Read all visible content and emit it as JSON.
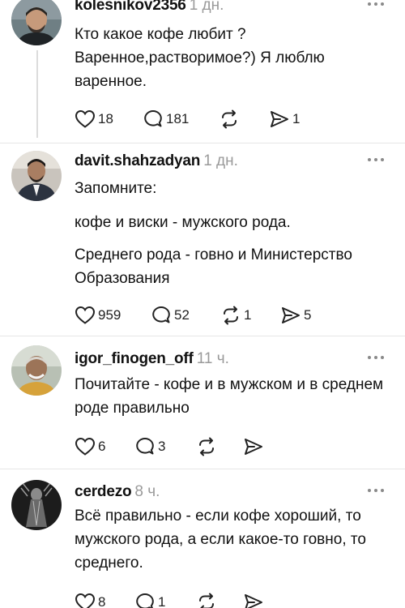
{
  "posts": [
    {
      "username": "kolesnikov2356",
      "time": "1 дн.",
      "paragraphs": [
        "Кто какое кофе любит ? Варенное,растворимое?) Я люблю варенное."
      ],
      "likes": "18",
      "replies": "181",
      "reposts": "",
      "shares": "1"
    },
    {
      "username": "davit.shahzadyan",
      "time": "1 дн.",
      "paragraphs": [
        "Запомните:",
        "кофе и виски - мужского рода.",
        "Среднего рода - говно и Министерство Образования"
      ],
      "likes": "959",
      "replies": "52",
      "reposts": "1",
      "shares": "5"
    },
    {
      "username": "igor_finogen_off",
      "time": "11 ч.",
      "paragraphs": [
        "Почитайте - кофе и в мужском и в среднем роде правильно"
      ],
      "likes": "6",
      "replies": "3",
      "reposts": "",
      "shares": ""
    },
    {
      "username": "cerdezo",
      "time": "8 ч.",
      "paragraphs": [
        "Всё правильно - если кофе хороший, то мужского рода, а если какое-то говно, то среднего."
      ],
      "likes": "8",
      "replies": "1",
      "reposts": "",
      "shares": ""
    }
  ],
  "icons": {
    "like": "heart-icon",
    "reply": "comment-bubble-icon",
    "repost": "repost-arrows-icon",
    "share": "send-arrow-icon",
    "more": "more-dots-icon"
  },
  "colors": {
    "text": "#111111",
    "muted": "#9a9a9a",
    "icon": "#222222",
    "divider": "#e6e6e6"
  }
}
